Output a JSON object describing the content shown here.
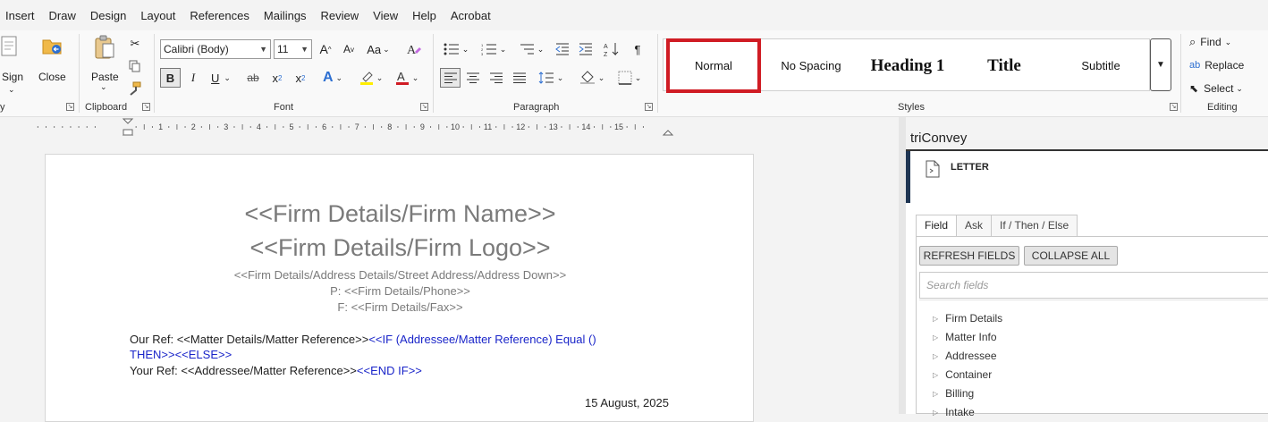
{
  "menu": [
    "Insert",
    "Draw",
    "Design",
    "Layout",
    "References",
    "Mailings",
    "Review",
    "View",
    "Help",
    "Acrobat"
  ],
  "ribbon": {
    "sign_label": "Sign",
    "close_label": "Close",
    "paste_label": "Paste",
    "clipboard_label": "Clipboard",
    "font_name": "Calibri (Body)",
    "font_size": "11",
    "font_label": "Font",
    "paragraph_label": "Paragraph",
    "styles_label": "Styles",
    "editing_label": "Editing",
    "find_label": "Find",
    "replace_label": "Replace",
    "select_label": "Select",
    "group_edge_label": "y",
    "bold": "B",
    "italic": "I",
    "underline": "U",
    "strike": "ab",
    "subscript": "x",
    "superscript": "x",
    "case": "Aa",
    "grow": "A",
    "shrink": "A",
    "pilcrow": "¶"
  },
  "styles": [
    {
      "label": "Normal",
      "selected": true
    },
    {
      "label": "No Spacing"
    },
    {
      "label": "Heading 1"
    },
    {
      "label": "Title"
    },
    {
      "label": "Subtitle"
    }
  ],
  "ruler": [
    "1",
    "2",
    "3",
    "4",
    "5",
    "6",
    "7",
    "8",
    "9",
    "10",
    "11",
    "12",
    "13",
    "14",
    "15"
  ],
  "document": {
    "firm_name": "<<Firm Details/Firm Name>>",
    "firm_logo": "<<Firm Details/Firm Logo>>",
    "address": "<<Firm Details/Address Details/Street Address/Address Down>>",
    "phone": "P:  <<Firm Details/Phone>>",
    "fax": "F:  <<Firm Details/Fax>>",
    "our_ref_prefix": "Our Ref: <<Matter Details/Matter Reference>>",
    "our_ref_if": "<<IF (Addressee/Matter Reference) Equal ()",
    "then_else": "THEN>><<ELSE>>",
    "your_ref": "Your Ref: <<Addressee/Matter Reference>>",
    "end_if": "<<END IF>>",
    "date": "15 August, 2025"
  },
  "pane": {
    "title": "triConvey",
    "template": "LETTER",
    "tabs": [
      "Field",
      "Ask",
      "If / Then / Else"
    ],
    "refresh_label": "REFRESH FIELDS",
    "collapse_label": "COLLAPSE ALL",
    "search_placeholder": "Search fields",
    "fields": [
      "Firm Details",
      "Matter Info",
      "Addressee",
      "Container",
      "Billing",
      "Intake"
    ]
  },
  "colors": {
    "selected_style_border": "#d01c24",
    "field_blue": "#1a25c9",
    "accent": "#1f3553"
  }
}
